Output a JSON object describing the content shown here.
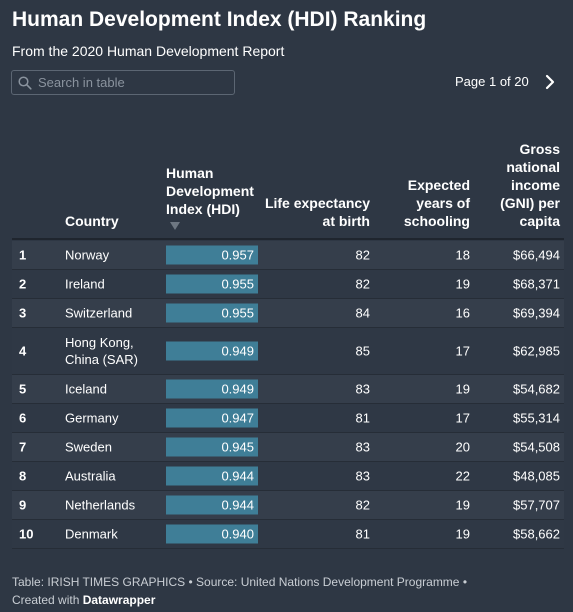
{
  "title": "Human Development Index (HDI) Ranking",
  "subtitle": "From the 2020 Human Development Report",
  "search": {
    "placeholder": "Search in table",
    "icon": "search-icon"
  },
  "pagination": {
    "label": "Page 1 of 20",
    "next_icon": "chevron-right-icon"
  },
  "columns": {
    "country": "Country",
    "hdi": "Human Development Index (HDI)",
    "life": "Life expectancy at birth",
    "school": "Expected years of schooling",
    "gni": "Gross national income (GNI) per capita"
  },
  "sort": {
    "column": "hdi",
    "direction": "descending"
  },
  "colors": {
    "background": "#2e3744",
    "bar": "#3f7e97"
  },
  "rows": [
    {
      "rank": "1",
      "country": "Norway",
      "hdi": "0.957",
      "life": "82",
      "school": "18",
      "gni": "$66,494"
    },
    {
      "rank": "2",
      "country": "Ireland",
      "hdi": "0.955",
      "life": "82",
      "school": "19",
      "gni": "$68,371"
    },
    {
      "rank": "3",
      "country": "Switzerland",
      "hdi": "0.955",
      "life": "84",
      "school": "16",
      "gni": "$69,394"
    },
    {
      "rank": "4",
      "country": "Hong Kong, China (SAR)",
      "country_line1": "Hong Kong,",
      "country_line2": "China (SAR)",
      "hdi": "0.949",
      "life": "85",
      "school": "17",
      "gni": "$62,985"
    },
    {
      "rank": "5",
      "country": "Iceland",
      "hdi": "0.949",
      "life": "83",
      "school": "19",
      "gni": "$54,682"
    },
    {
      "rank": "6",
      "country": "Germany",
      "hdi": "0.947",
      "life": "81",
      "school": "17",
      "gni": "$55,314"
    },
    {
      "rank": "7",
      "country": "Sweden",
      "hdi": "0.945",
      "life": "83",
      "school": "20",
      "gni": "$54,508"
    },
    {
      "rank": "8",
      "country": "Australia",
      "hdi": "0.944",
      "life": "83",
      "school": "22",
      "gni": "$48,085"
    },
    {
      "rank": "9",
      "country": "Netherlands",
      "hdi": "0.944",
      "life": "82",
      "school": "19",
      "gni": "$57,707"
    },
    {
      "rank": "10",
      "country": "Denmark",
      "hdi": "0.940",
      "life": "81",
      "school": "19",
      "gni": "$58,662"
    }
  ],
  "footer": {
    "line1": "Table: IRISH TIMES GRAPHICS • Source: United Nations Development Programme •",
    "created_prefix": "Created with ",
    "created_brand": "Datawrapper"
  }
}
